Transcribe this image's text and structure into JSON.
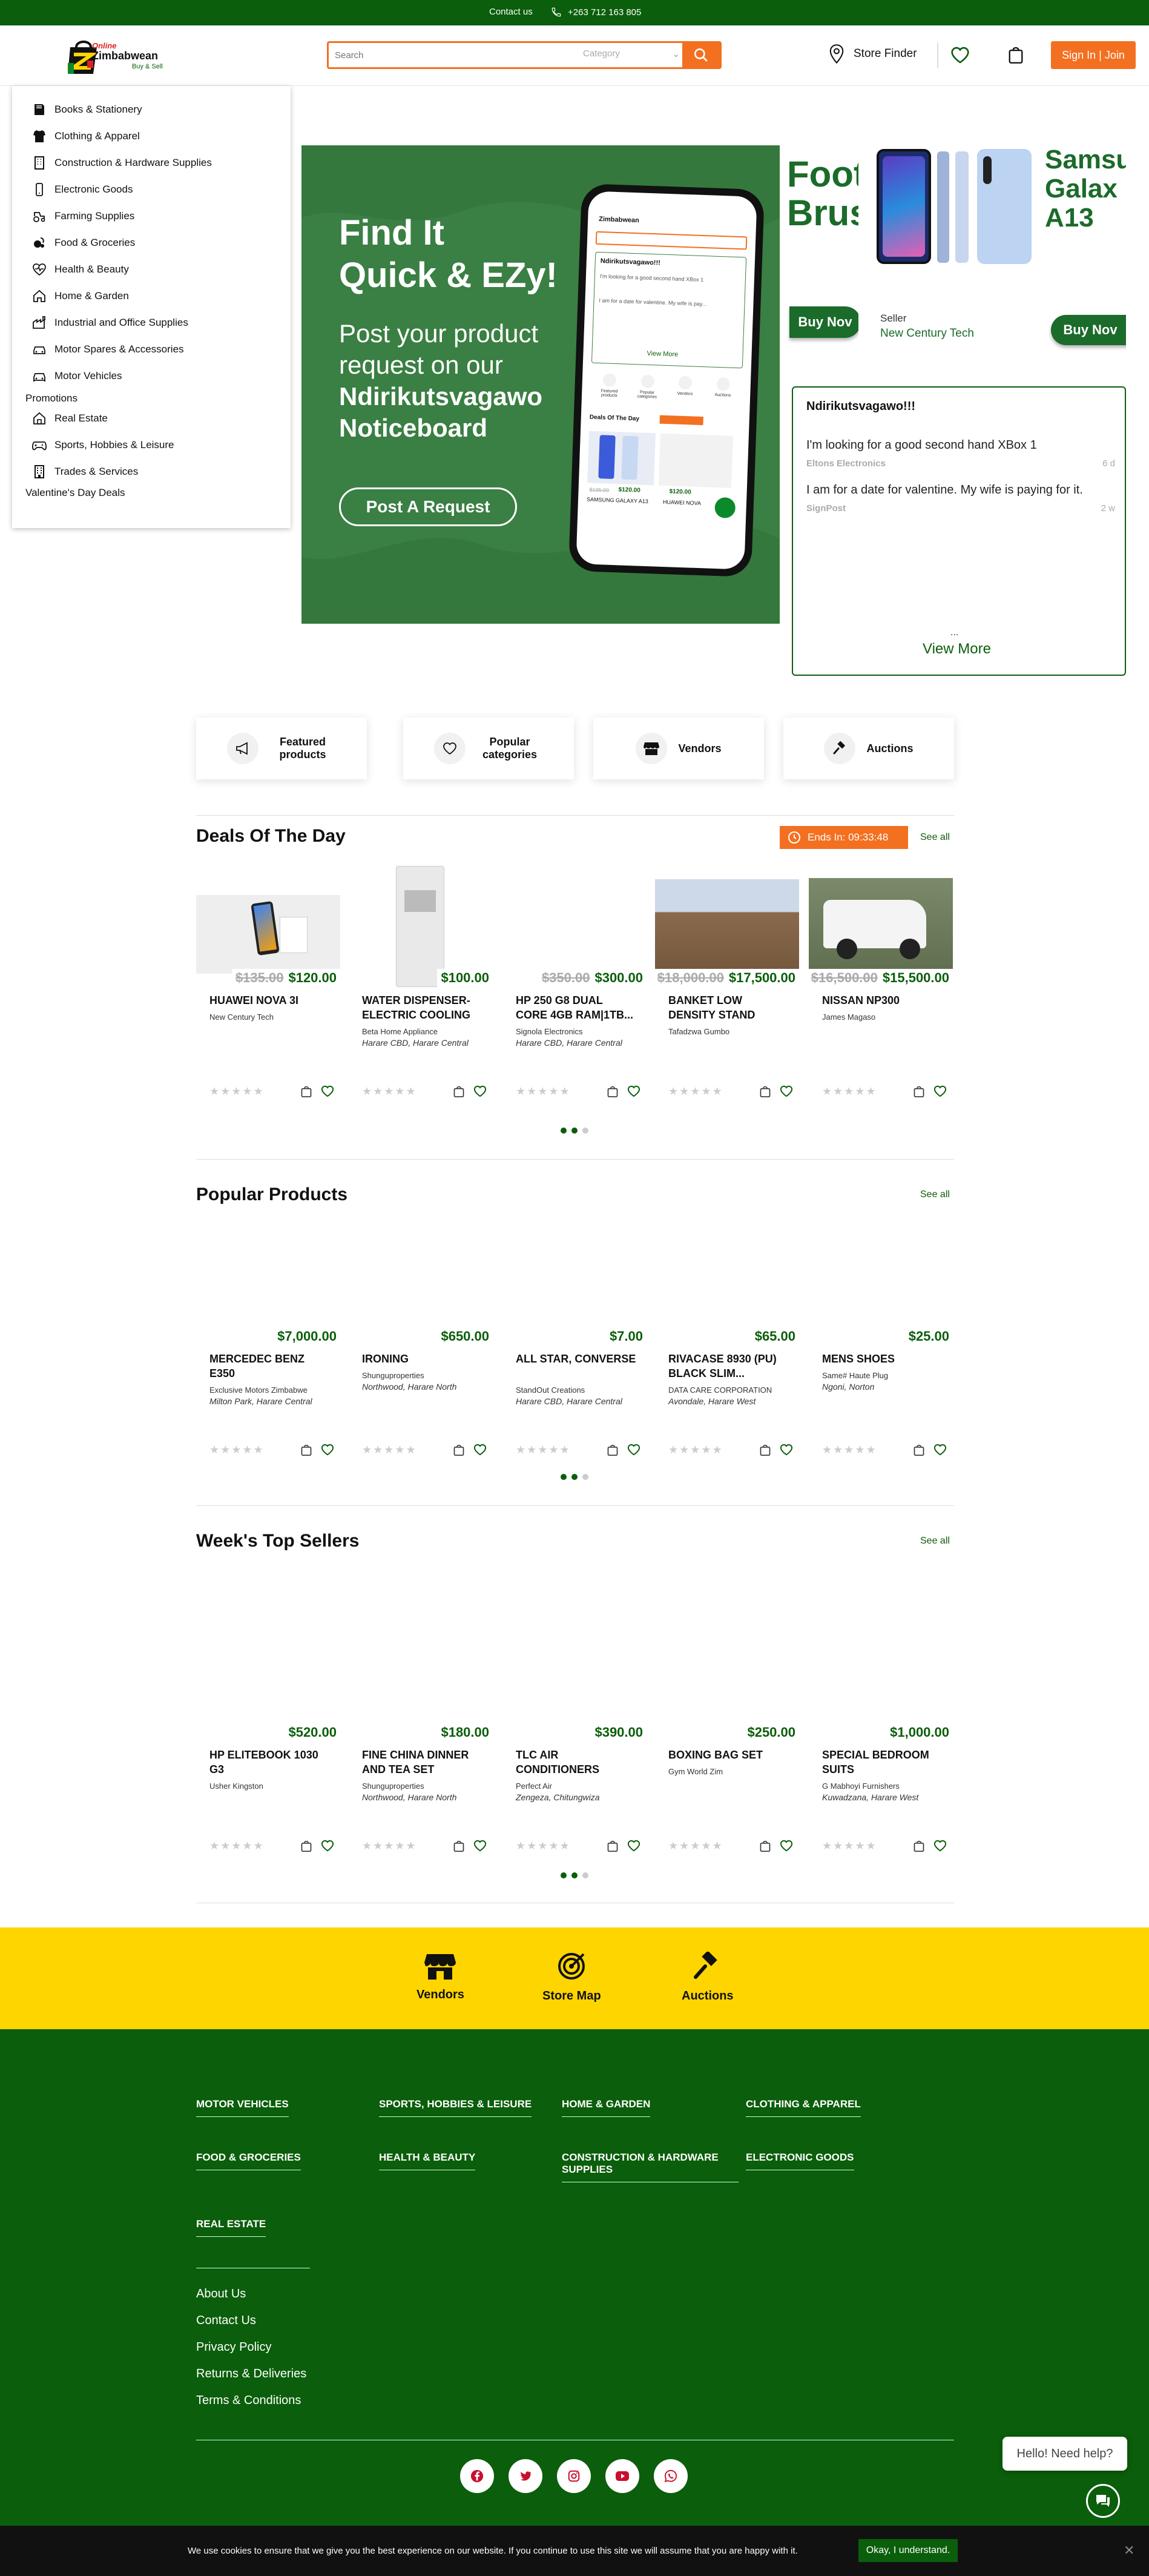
{
  "topbar": {
    "contact": "Contact us",
    "phone": "+263 712 163 805"
  },
  "header": {
    "logo_text": "Zimbabwean",
    "logo_tagline": "Buy & Sell",
    "search_placeholder": "Search",
    "category_placeholder": "Category",
    "store_finder": "Store Finder",
    "signin": "Sign In | Join"
  },
  "sidebar": {
    "items": [
      {
        "label": "Books & Stationery",
        "icon": "book-icon"
      },
      {
        "label": "Clothing & Apparel",
        "icon": "shirt-icon"
      },
      {
        "label": "Construction & Hardware Supplies",
        "icon": "building-icon"
      },
      {
        "label": "Electronic Goods",
        "icon": "phone-icon"
      },
      {
        "label": "Farming Supplies",
        "icon": "tractor-icon"
      },
      {
        "label": "Food & Groceries",
        "icon": "food-icon"
      },
      {
        "label": "Health & Beauty",
        "icon": "heart-pulse-icon"
      },
      {
        "label": "Home & Garden",
        "icon": "home-icon"
      },
      {
        "label": "Industrial and Office Supplies",
        "icon": "factory-icon"
      },
      {
        "label": "Motor Spares & Accessories",
        "icon": "car-parts-icon"
      },
      {
        "label": "Motor Vehicles",
        "icon": "car-icon"
      }
    ],
    "promotions": "Promotions",
    "items2": [
      {
        "label": "Real Estate",
        "icon": "house-icon"
      },
      {
        "label": "Sports, Hobbies & Leisure",
        "icon": "gamepad-icon"
      },
      {
        "label": "Trades & Services",
        "icon": "office-icon"
      }
    ],
    "valentine": "Valentine's Day Deals"
  },
  "hero": {
    "headline1": "Find It",
    "headline2": "Quick & EZy!",
    "sub1": "Post your product request on our",
    "sub2": "Ndirikutsvagawo Noticeboard",
    "button": "Post A Request",
    "phone_title": "Ndirikutsvagawo!!!",
    "phone_line1": "I'm looking for a good second hand XBox 1",
    "phone_line2": "I am for a date for valentine. My wife is pay...",
    "phone_view_more": "View More",
    "phone_deals": "Deals Of The Day",
    "phone_price_old": "$135.00",
    "phone_price_new": "$120.00",
    "phone_price2": "$120.00",
    "phone_item1": "SAMSUNG GALAXY A13",
    "phone_item2": "HUAWEI NOVA",
    "phone_icons": [
      "Featured products",
      "Popular categories",
      "Vendors",
      "Auctions"
    ]
  },
  "promo": {
    "left_text_1": "Foot",
    "left_text_2": "Brus",
    "left_button": "Buy Nov",
    "title_1": "Samsu",
    "title_2": "Galax",
    "title_3": "A13",
    "seller_label": "Seller",
    "seller_name": "New Century Tech",
    "button": "Buy Nov"
  },
  "noticeboard": {
    "title": "Ndirikutsvagawo!!!",
    "posts": [
      {
        "text": "I'm looking for a good second hand XBox 1",
        "author": "Eltons Electronics",
        "age": "6 d"
      },
      {
        "text": "I am for a date for valentine. My wife is paying for it.",
        "author": "SignPost",
        "age": "2 w"
      }
    ],
    "ellipsis": "...",
    "view_more": "View More"
  },
  "quick_links": [
    {
      "label": "Featured products",
      "icon": "megaphone-icon"
    },
    {
      "label": "Popular categories",
      "icon": "heart-icon"
    },
    {
      "label": "Vendors",
      "icon": "store-icon"
    },
    {
      "label": "Auctions",
      "icon": "gavel-icon"
    }
  ],
  "deals": {
    "title": "Deals Of The Day",
    "timer": "Ends In: 09:33:48",
    "see_all": "See all",
    "products": [
      {
        "old": "$135.00",
        "price": "$120.00",
        "name": "HUAWEI NOVA 3I",
        "vendor": "New Century Tech",
        "loc": ""
      },
      {
        "old": "",
        "price": "$100.00",
        "name": "WATER DISPENSER- ELECTRIC COOLING",
        "vendor": "Beta Home Appliance",
        "loc": "Harare CBD, Harare Central"
      },
      {
        "old": "$350.00",
        "price": "$300.00",
        "name": "HP 250 G8 DUAL CORE 4GB RAM|1TB...",
        "vendor": "Signola Electronics",
        "loc": "Harare CBD, Harare Central"
      },
      {
        "old": "$18,000.00",
        "price": "$17,500.00",
        "name": "BANKET LOW DENSITY STAND",
        "vendor": "Tafadzwa Gumbo",
        "loc": ""
      },
      {
        "old": "$16,500.00",
        "price": "$15,500.00",
        "name": "NISSAN NP300",
        "vendor": "James Magaso",
        "loc": ""
      }
    ]
  },
  "popular": {
    "title": "Popular Products",
    "see_all": "See all",
    "products": [
      {
        "price": "$7,000.00",
        "name": "MERCEDEC BENZ E350",
        "vendor": "Exclusive Motors Zimbabwe",
        "loc": "Milton Park, Harare Central"
      },
      {
        "price": "$650.00",
        "name": "IRONING",
        "vendor": "Shunguproperties",
        "loc": "Northwood, Harare North"
      },
      {
        "price": "$7.00",
        "name": "ALL STAR, CONVERSE",
        "vendor": "StandOut Creations",
        "loc": "Harare CBD, Harare Central"
      },
      {
        "price": "$65.00",
        "name": "RIVACASE 8930 (PU) BLACK SLIM...",
        "vendor": "DATA CARE CORPORATION",
        "loc": "Avondale, Harare West"
      },
      {
        "price": "$25.00",
        "name": "MENS SHOES",
        "vendor": "Same# Haute Plug",
        "loc": "Ngoni, Norton"
      }
    ]
  },
  "top_sellers": {
    "title": "Week's Top Sellers",
    "see_all": "See all",
    "products": [
      {
        "price": "$520.00",
        "name": "HP ELITEBOOK 1030 G3",
        "vendor": "Usher Kingston",
        "loc": ""
      },
      {
        "price": "$180.00",
        "name": "FINE CHINA DINNER AND TEA SET",
        "vendor": "Shunguproperties",
        "loc": "Northwood, Harare North"
      },
      {
        "price": "$390.00",
        "name": "TLC AIR CONDITIONERS",
        "vendor": "Perfect Air",
        "loc": "Zengeza, Chitungwiza"
      },
      {
        "price": "$250.00",
        "name": "BOXING BAG SET",
        "vendor": "Gym World Zim",
        "loc": ""
      },
      {
        "price": "$1,000.00",
        "name": "SPECIAL BEDROOM SUITS",
        "vendor": "G Mabhoyi Furnishers",
        "loc": "Kuwadzana, Harare West"
      }
    ]
  },
  "yellow_band": [
    {
      "label": "Vendors",
      "icon": "store-icon"
    },
    {
      "label": "Store Map",
      "icon": "target-icon"
    },
    {
      "label": "Auctions",
      "icon": "gavel-icon"
    }
  ],
  "footer": {
    "categories": [
      "MOTOR VEHICLES",
      "SPORTS, HOBBIES & LEISURE",
      "HOME & GARDEN",
      "CLOTHING & APPAREL",
      "FOOD & GROCERIES",
      "HEALTH & BEAUTY",
      "CONSTRUCTION & HARDWARE SUPPLIES",
      "ELECTRONIC GOODS",
      "REAL ESTATE"
    ],
    "links": [
      "About Us",
      "Contact Us",
      "Privacy Policy",
      "Returns & Deliveries",
      "Terms & Conditions"
    ],
    "social": [
      "facebook-icon",
      "twitter-icon",
      "instagram-icon",
      "youtube-icon",
      "whatsapp-icon"
    ]
  },
  "help": {
    "text": "Hello! Need help?"
  },
  "cookie": {
    "text": "We use cookies to ensure that we give you the best experience on our website. If you continue to use this site we will assume that you are happy with it.",
    "button": "Okay, I understand."
  },
  "colors": {
    "brand_green": "#0b5e0b",
    "accent_orange": "#f37021",
    "yellow": "#ffd500"
  }
}
